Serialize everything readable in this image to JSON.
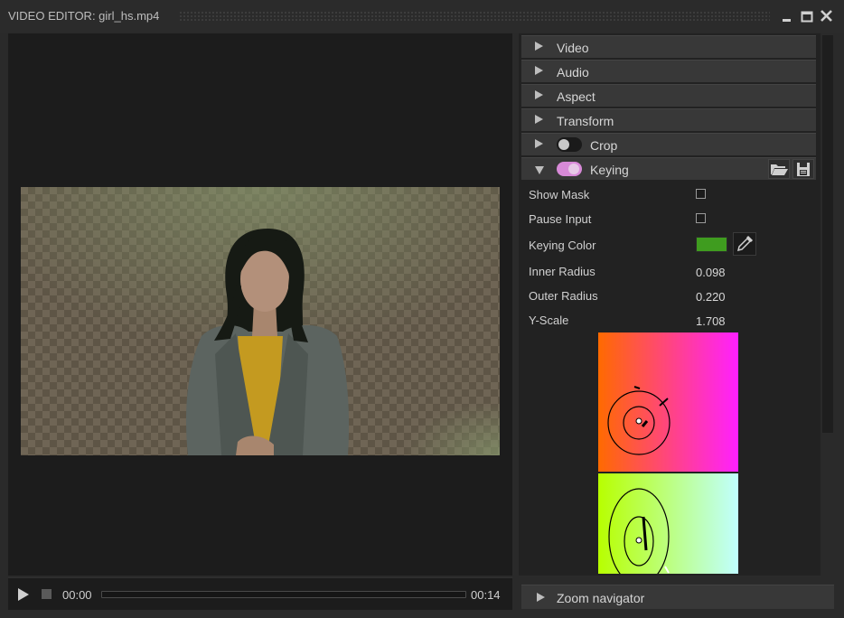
{
  "window": {
    "title": "VIDEO EDITOR: girl_hs.mp4",
    "icons": [
      "minimize-icon",
      "maximize-icon",
      "close-icon"
    ]
  },
  "transport": {
    "current_time": "00:00",
    "duration": "00:14",
    "progress": 0.0
  },
  "sections": {
    "video": "Video",
    "audio": "Audio",
    "aspect": "Aspect",
    "transform": "Transform",
    "crop": "Crop",
    "keying": "Keying"
  },
  "crop_enabled": false,
  "keying_enabled": true,
  "keying": {
    "show_mask_label": "Show Mask",
    "show_mask": false,
    "pause_input_label": "Pause Input",
    "pause_input": false,
    "keying_color_label": "Keying Color",
    "keying_color": "#3f9c1f",
    "inner_radius_label": "Inner Radius",
    "inner_radius": "0.098",
    "outer_radius_label": "Outer Radius",
    "outer_radius": "0.220",
    "y_scale_label": "Y-Scale",
    "y_scale": "1.708"
  },
  "zoom_navigator": "Zoom navigator",
  "colors": {
    "accent_toggle": "#d88ad8",
    "panel_bg": "#222222",
    "header_bg": "#383838"
  }
}
